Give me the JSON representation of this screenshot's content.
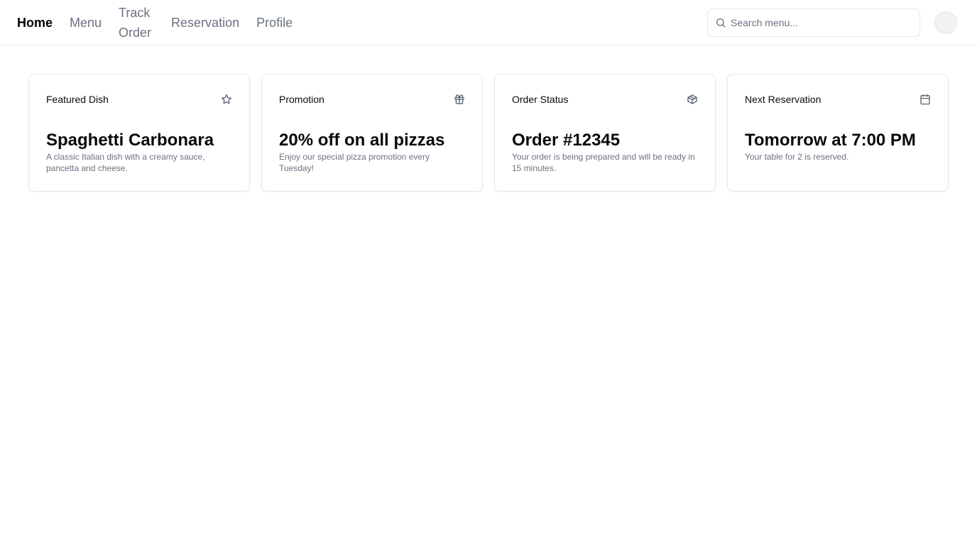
{
  "nav": {
    "links": [
      {
        "label": "Home",
        "active": true
      },
      {
        "label": "Menu",
        "active": false
      },
      {
        "label": "Track Order",
        "active": false
      },
      {
        "label": "Reservation",
        "active": false
      },
      {
        "label": "Profile",
        "active": false
      }
    ]
  },
  "search": {
    "placeholder": "Search menu...",
    "value": "",
    "icon": "search-icon"
  },
  "avatar": {
    "icon": "avatar"
  },
  "cards": [
    {
      "title": "Featured Dish",
      "icon": "star-icon",
      "heading": "Spaghetti Carbonara",
      "description": "A classic Italian dish with a creamy sauce, pancetta and cheese."
    },
    {
      "title": "Promotion",
      "icon": "gift-icon",
      "heading": "20% off on all pizzas",
      "description": "Enjoy our special pizza promotion every Tuesday!"
    },
    {
      "title": "Order Status",
      "icon": "package-icon",
      "heading": "Order #12345",
      "description": "Your order is being prepared and will be ready in 15 minutes."
    },
    {
      "title": "Next Reservation",
      "icon": "calendar-icon",
      "heading": "Tomorrow at 7:00 PM",
      "description": "Your table for 2 is reserved."
    }
  ],
  "colors": {
    "text": "#0a0a0a",
    "muted": "#6b7280",
    "border": "#e5e7eb",
    "background": "#ffffff"
  }
}
